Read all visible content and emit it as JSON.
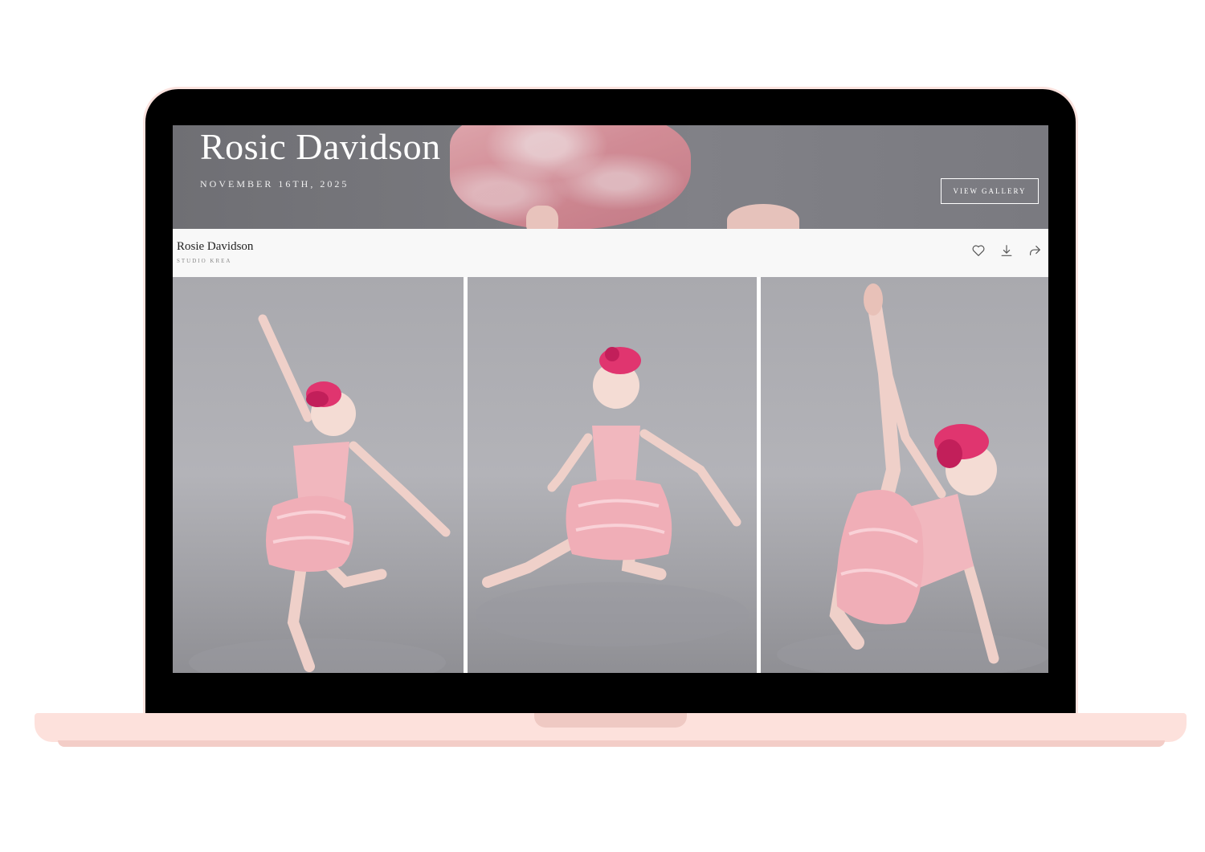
{
  "hero": {
    "title": "Rosic Davidson",
    "date": "NOVEMBER 16TH, 2025",
    "button_label": "VIEW GALLERY"
  },
  "gallery": {
    "title": "Rosie Davidson",
    "subtitle": "STUDIO KREA",
    "icons": [
      "heart-icon",
      "download-icon",
      "share-icon"
    ]
  },
  "colors": {
    "laptop_base": "#fde1dc",
    "hero_overlay": "#77777c",
    "costume_pink": "#eeb3ba",
    "headpiece_pink": "#e0356f"
  }
}
